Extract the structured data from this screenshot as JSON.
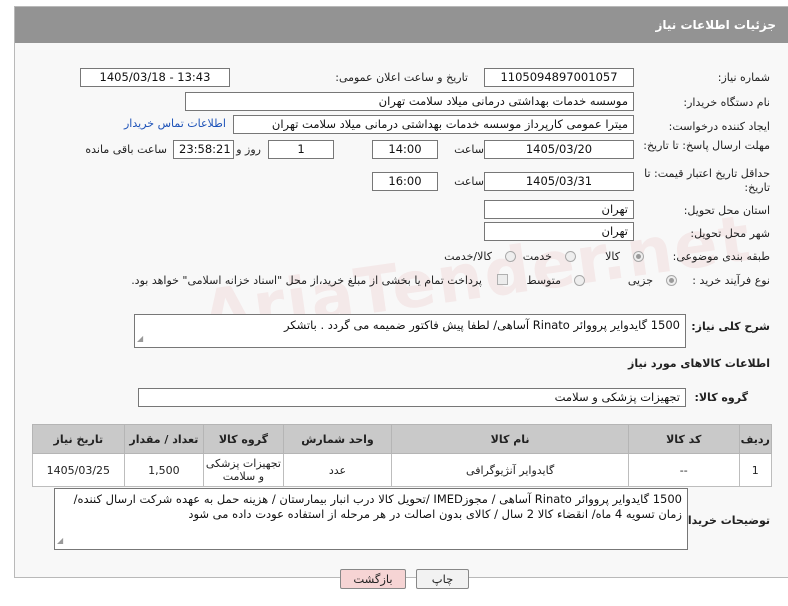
{
  "header": {
    "title": "جزئیات اطلاعات نیاز"
  },
  "form": {
    "need_number_label": "شماره نیاز:",
    "need_number": "1105094897001057",
    "announce_label": "تاریخ و ساعت اعلان عمومی:",
    "announce_value": "1405/03/18 - 13:43",
    "buyer_org_label": "نام دستگاه خریدار:",
    "buyer_org": "موسسه خدمات بهداشتی درمانی میلاد سلامت تهران",
    "requester_label": "ایجاد کننده درخواست:",
    "requester": "میترا عمومی کارپرداز موسسه خدمات بهداشتی درمانی میلاد سلامت تهران",
    "buyer_contact_link": "اطلاعات تماس خریدار",
    "reply_deadline_label": "مهلت ارسال پاسخ: تا تاریخ:",
    "reply_date": "1405/03/20",
    "time_label": "ساعت",
    "reply_time": "14:00",
    "days": "1",
    "days_label": "روز و",
    "remaining_time": "23:58:21",
    "remaining_label": "ساعت باقی مانده",
    "price_validity_label": "حداقل تاریخ اعتبار قیمت: تا تاریخ:",
    "price_date": "1405/03/31",
    "time_label_2": "ساعت",
    "price_time": "16:00",
    "province_label": "استان محل تحویل:",
    "province": "تهران",
    "city_label": "شهر محل تحویل:",
    "city": "تهران",
    "category_label": "طبقه بندی موضوعی:",
    "category_options": [
      "کالا",
      "خدمت",
      "کالا/خدمت"
    ],
    "category_selected": "کالا",
    "process_label": "نوع فرآیند خرید :",
    "process_options": [
      "جزیی",
      "متوسط"
    ],
    "process_selected": "جزیی",
    "payment_note": "پرداخت تمام یا بخشی از مبلغ خرید،از محل \"اسناد خزانه اسلامی\" خواهد بود."
  },
  "description": {
    "label": "شرح کلی نیاز:",
    "text": "1500 گایدوایر پرووائر Rinato   آساهی/ لطفا پیش فاکتور ضمیمه می گردد . باتشکر"
  },
  "goods": {
    "section_title": "اطلاعات کالاهای مورد نیاز",
    "group_label": "گروه کالا:",
    "group_value": "تجهیزات پزشکی و سلامت",
    "columns": [
      "ردیف",
      "کد کالا",
      "نام کالا",
      "واحد شمارش",
      "گروه کالا",
      "تعداد / مقدار",
      "تاریخ نیاز"
    ],
    "rows": [
      {
        "row": "1",
        "code": "--",
        "name": "گایدوایر آنژیوگرافی",
        "unit": "عدد",
        "group": "تجهیزات پزشکی و سلامت",
        "qty": "1,500",
        "date": "1405/03/25"
      }
    ]
  },
  "buyer_notes": {
    "label": "توضیحات خریدار:",
    "text": "1500 گایدوایر پرووائر Rinato   آساهی / مجوزIMED /تحویل کالا درب انبار بیمارستان / هزینه حمل به عهده شرکت ارسال کننده/ زمان تسویه 4 ماه/ انقضاء کالا 2 سال / کالای بدون اصالت در هر مرحله از استفاده عودت داده می شود"
  },
  "buttons": {
    "print": "چاپ",
    "back": "بازگشت"
  },
  "watermark": "AriaTender.net",
  "colors": {
    "header_bg": "#939393",
    "link": "#1d52b8",
    "back_button_bg": "#f6d4d4"
  }
}
